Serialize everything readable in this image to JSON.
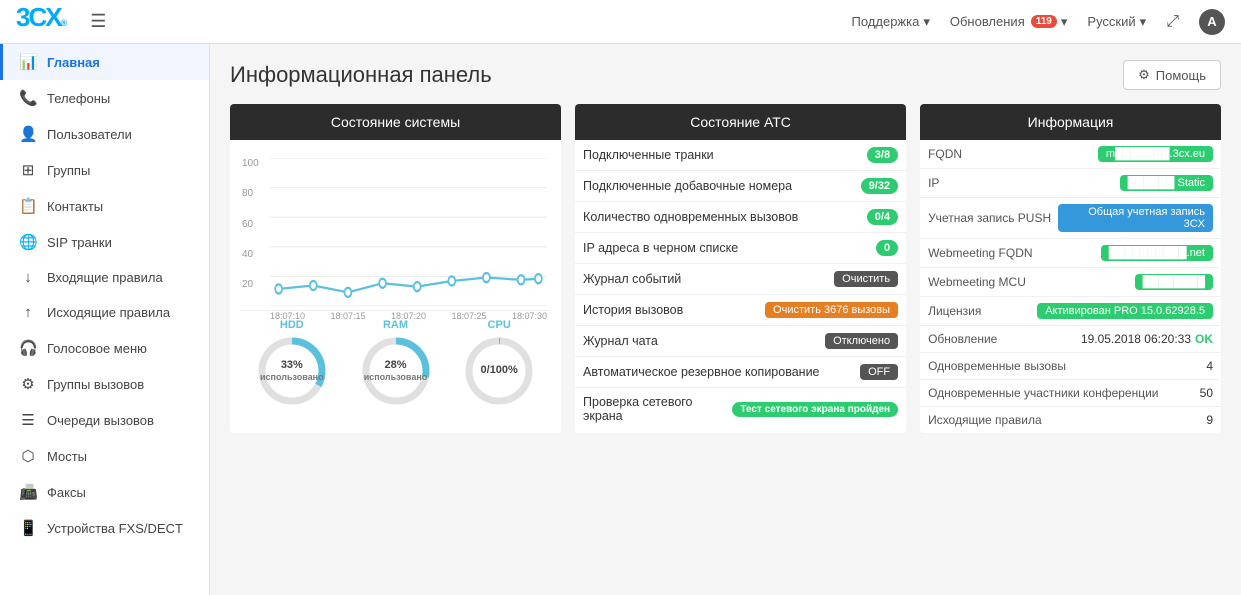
{
  "topbar": {
    "logo": "3CX",
    "logo_r": "®",
    "support_label": "Поддержка",
    "updates_label": "Обновления",
    "updates_badge": "119",
    "lang_label": "Русский",
    "expand_icon": "⤢",
    "user_icon": "A"
  },
  "sidebar": {
    "items": [
      {
        "id": "home",
        "label": "Главная",
        "icon": "📊",
        "active": true
      },
      {
        "id": "phones",
        "label": "Телефоны",
        "icon": "📞"
      },
      {
        "id": "users",
        "label": "Пользователи",
        "icon": "👤"
      },
      {
        "id": "groups",
        "label": "Группы",
        "icon": "⊞"
      },
      {
        "id": "contacts",
        "label": "Контакты",
        "icon": "📋"
      },
      {
        "id": "sip",
        "label": "SIP транки",
        "icon": "🌐"
      },
      {
        "id": "inbound",
        "label": "Входящие правила",
        "icon": "↓"
      },
      {
        "id": "outbound",
        "label": "Исходящие правила",
        "icon": "↑"
      },
      {
        "id": "ivr",
        "label": "Голосовое меню",
        "icon": "🎧"
      },
      {
        "id": "callgroups",
        "label": "Группы вызовов",
        "icon": "⚙"
      },
      {
        "id": "queues",
        "label": "Очереди вызовов",
        "icon": "☰"
      },
      {
        "id": "bridges",
        "label": "Мосты",
        "icon": "⬡"
      },
      {
        "id": "fax",
        "label": "Факсы",
        "icon": "📠"
      },
      {
        "id": "fxs",
        "label": "Устройства FXS/DECT",
        "icon": "📱"
      }
    ]
  },
  "page": {
    "title": "Информационная панель",
    "help_label": "Помощь"
  },
  "system_status": {
    "title": "Состояние системы",
    "chart_labels": [
      "18:07:10",
      "18:07:15",
      "18:07:20",
      "18:07:25",
      "18:07:30"
    ],
    "y_labels": [
      "100",
      "80",
      "60",
      "40",
      "20"
    ],
    "hdd_label": "HDD",
    "ram_label": "RAM",
    "cpu_label": "CPU",
    "hdd_percent": 33,
    "hdd_text": "33%\nиспользовано",
    "ram_percent": 28,
    "ram_text": "28%\nиспользовано",
    "cpu_value": "0/100%"
  },
  "atc_status": {
    "title": "Состояние АТС",
    "rows": [
      {
        "label": "Подключенные транки",
        "badge": "3/8",
        "type": "green"
      },
      {
        "label": "Подключенные добавочные номера",
        "badge": "9/32",
        "type": "green"
      },
      {
        "label": "Количество одновременных вызовов",
        "badge": "0/4",
        "type": "green"
      },
      {
        "label": "IP адреса в черном списке",
        "badge": "0",
        "type": "green"
      },
      {
        "label": "Журнал событий",
        "badge": "Очистить",
        "type": "dark"
      },
      {
        "label": "История вызовов",
        "badge": "Очистить 3676 вызовы",
        "type": "orange"
      },
      {
        "label": "Журнал чата",
        "badge": "Отключено",
        "type": "dark"
      },
      {
        "label": "Автоматическое резервное копирование",
        "badge": "OFF",
        "type": "dark"
      },
      {
        "label": "Проверка сетевого экрана",
        "badge": "Тест сетевого экрана пройден",
        "type": "green_big"
      }
    ]
  },
  "info": {
    "title": "Информация",
    "rows": [
      {
        "label": "FQDN",
        "value": "m██████.3cx.eu",
        "type": "green"
      },
      {
        "label": "IP",
        "value": "██████ Static",
        "type": "green"
      },
      {
        "label": "Учетная запись PUSH",
        "value": "Общая учетная запись 3CX",
        "type": "blue"
      },
      {
        "label": "Webmeeting FQDN",
        "value": "██████████.net",
        "type": "green"
      },
      {
        "label": "Webmeeting MCU",
        "value": "████████",
        "type": "green"
      },
      {
        "label": "Лицензия",
        "value": "Активирован PRO 15.0.62928.5",
        "type": "green"
      },
      {
        "label": "Обновление",
        "value": "19.05.2018 06:20:33",
        "ok": "OK",
        "type": "text_ok"
      },
      {
        "label": "Одновременные вызовы",
        "value": "4",
        "type": "num"
      },
      {
        "label": "Одновременные участники конференции",
        "value": "50",
        "type": "num"
      },
      {
        "label": "Исходящие правила",
        "value": "9",
        "type": "num"
      }
    ]
  }
}
